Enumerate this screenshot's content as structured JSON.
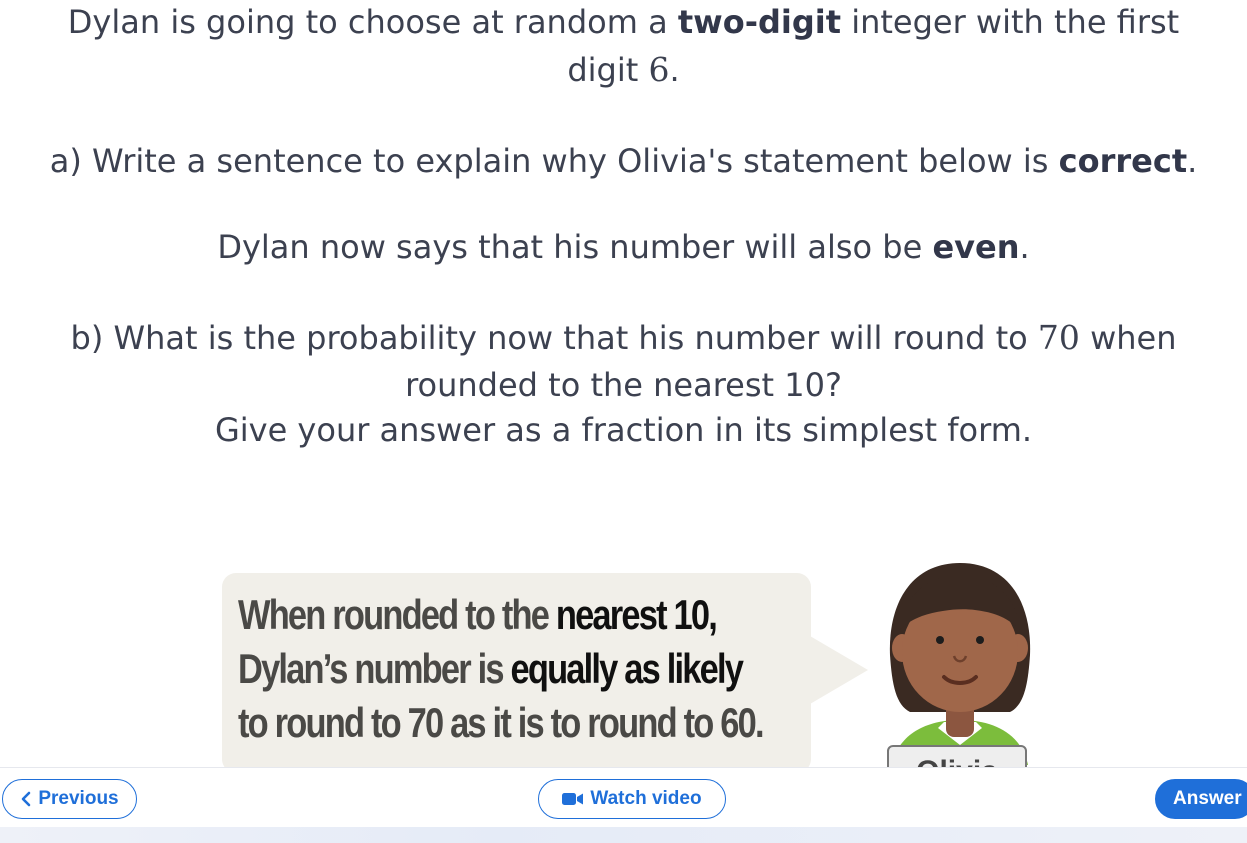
{
  "question": {
    "line1_pre": "Dylan is going to choose at random a ",
    "line1_bold": "two-digit",
    "line1_post": " integer with the first",
    "line2_pre": "digit ",
    "line2_math": "6",
    "line2_post": ".",
    "part_a_pre": "a) Write a sentence to explain why Olivia's statement below is ",
    "part_a_bold": "correct",
    "part_a_post": ".",
    "statement_pre": "Dylan now says that his number will also be ",
    "statement_bold": "even",
    "statement_post": ".",
    "part_b_pre": "b) What is the probability now that his number will round to ",
    "part_b_math": "70",
    "part_b_post": " when",
    "part_b_line2": "rounded to the nearest 10?",
    "part_b_line3": "Give your answer as a fraction in its simplest form."
  },
  "speech_bubble": {
    "l1_pre": "When rounded to the ",
    "l1_bold": "nearest 10,",
    "l2_pre": "Dylan’s number is ",
    "l2_bold": "equally as likely",
    "l3": "to round to 70 as it is to round to 60."
  },
  "character": {
    "name": "Olivia",
    "skin_color": "#a0674a",
    "hair_color": "#3a2a22",
    "shirt_color": "#7cbd3c"
  },
  "footer": {
    "previous_label": "Previous",
    "previous_icon": "chevron-left-icon",
    "video_label": "Watch video",
    "video_icon": "video-camera-icon",
    "answer_label": "Answer"
  },
  "colors": {
    "accent": "#1f6fd9",
    "text": "#3c4150"
  }
}
